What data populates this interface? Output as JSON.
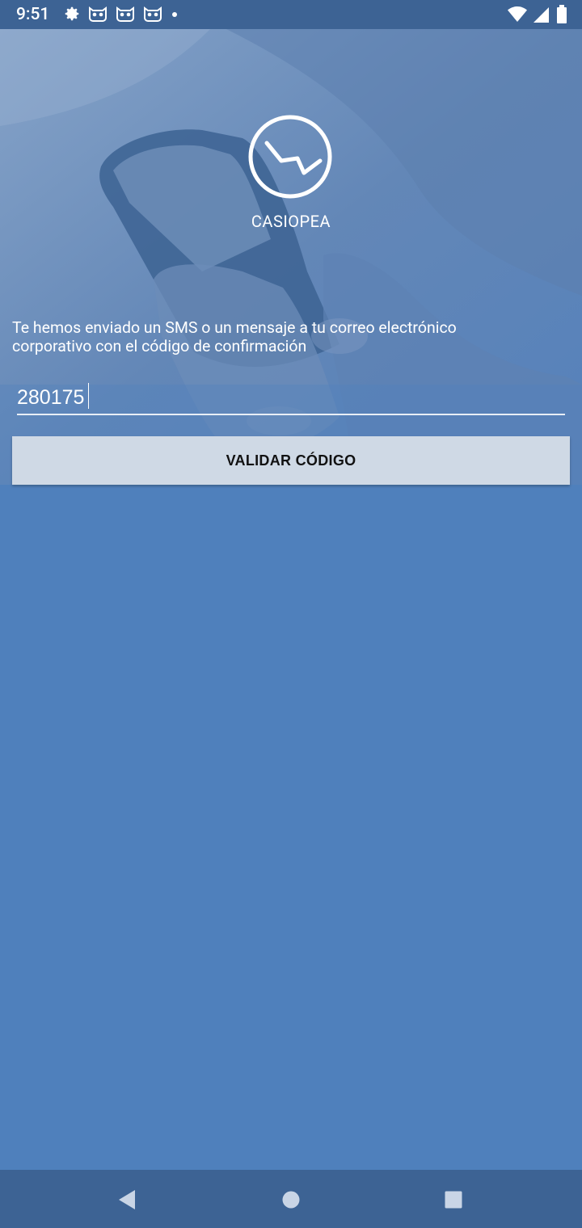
{
  "status_bar": {
    "time": "9:51",
    "left_icons": [
      "gear-icon",
      "cat-face-icon",
      "cat-face-icon",
      "cat-face-icon",
      "dot-icon"
    ],
    "right_icons": [
      "wifi-icon",
      "signal-icon",
      "battery-icon"
    ]
  },
  "brand": {
    "name": "CASIOPEA"
  },
  "verification": {
    "message": "Te hemos enviado un SMS o un mensaje a tu correo electrónico corporativo con el código de confirmación",
    "code_value": "280175",
    "button_label": "VALIDAR CÓDIGO"
  },
  "nav_bar": {
    "buttons": [
      "back-icon",
      "home-icon",
      "recents-icon"
    ]
  },
  "colors": {
    "background": "#4f80bc",
    "bars": "#3d6394",
    "button_bg": "#cfd9e5",
    "text": "#ffffff"
  }
}
